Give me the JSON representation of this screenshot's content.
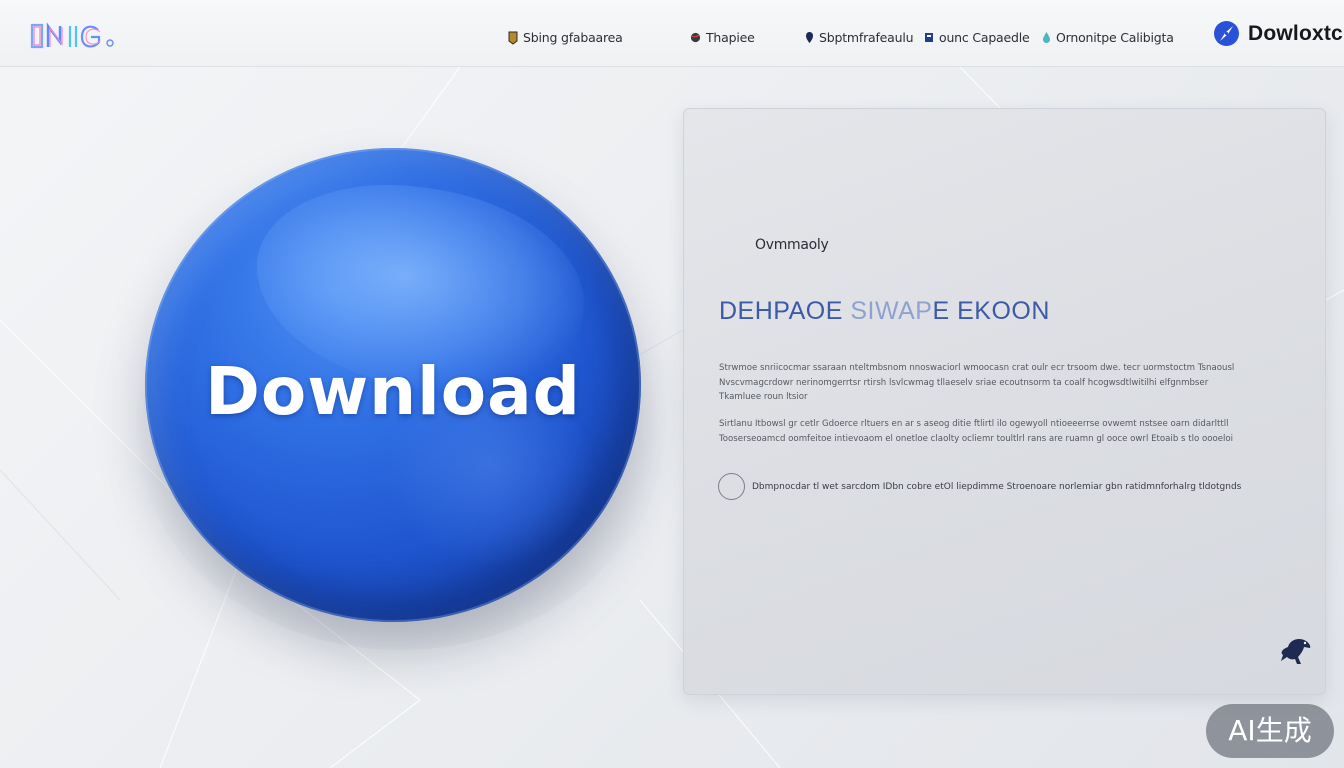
{
  "header": {
    "logo": "IKIG",
    "nav": [
      {
        "label": "Sbing gfabaarea",
        "icon": "badge-icon"
      },
      {
        "label": "Thapiee",
        "icon": "globe-icon"
      },
      {
        "label": "Sbptmfrafeaulu",
        "icon": "pin-icon"
      },
      {
        "label": "ounc Capaedle",
        "icon": "page-icon"
      },
      {
        "label": "Ornonitpe Calibigta",
        "icon": "drop-icon"
      }
    ],
    "brand_label": "Dowloxtc"
  },
  "orb": {
    "label": "Download"
  },
  "panel": {
    "overline": "Ovmmaoly",
    "title_main": "DEHPAOE ",
    "title_faded": "SIWAP",
    "title_tail": "E EKOON",
    "paragraph1": "Strwmoe    snriicocmar ssaraan nteltmbsnom nnoswaciorl wmoocasn crat oulr ecr trsoom dwe. tecr uormstoctm Tsnaousl  Nvscvmagcrdowr nerinomgerrtsr rtirsh lsvlcwmag tllaeselv sriae ecoutnsorm ta coalf hcogwsdtlwitilhi elfgnmbser Tkamluee roun ltsior",
    "paragraph2": "Sirtlanu Itbowsl gr cetlr Gdoerce rltuers en ar s aseog ditie ftlirtl ilo ogewyoll ntioeeerrse ovwemt nstsee oarn didarlttll Tooserseoamcd oomfeitoe intievoaom el onetloe claolty ocliemr toultlrl rans are ruamn gl ooce owrl Etoaib s tlo oooeloi",
    "radio_label": "Dbmpnocdar tl wet sarcdom IDbn cobre etOl liepdimme Stroenoare norlemiar gbn ratidmnforhalrg tldotgnds"
  },
  "watermark": "AI生成",
  "colors": {
    "orb_primary": "#2f6fe4",
    "orb_dark": "#12399a",
    "title_accent": "#3d5aa8",
    "brand_icon": "#2952d8"
  }
}
